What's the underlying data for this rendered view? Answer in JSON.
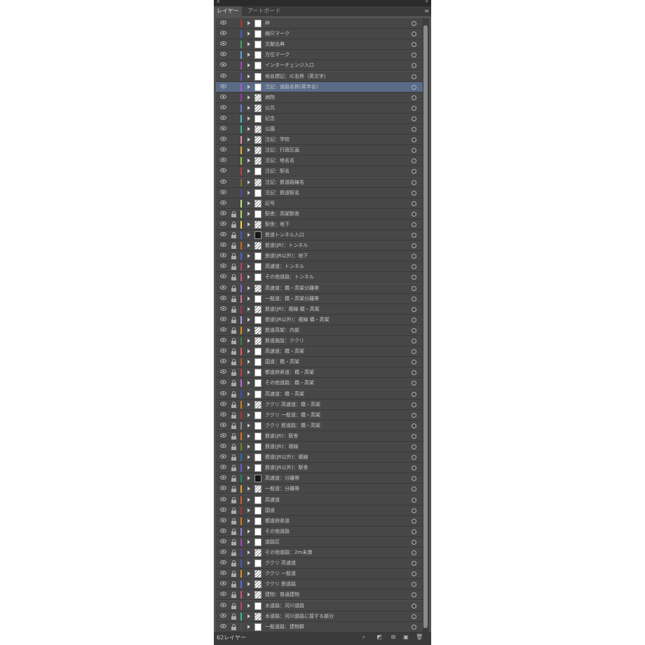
{
  "panel": {
    "tabs": [
      "レイヤー",
      "アートボード"
    ],
    "active_tab_index": 0,
    "menu_icon": "panel-menu-icon",
    "close_glyph": "x",
    "collapse_glyph": "«"
  },
  "layers": [
    {
      "name": "枠",
      "color": "#c92a2a",
      "locked": false,
      "thumb": "white"
    },
    {
      "name": "縮尺マーク",
      "color": "#3b5bdb",
      "locked": false,
      "thumb": "white"
    },
    {
      "name": "文献出典",
      "color": "#2fb24a",
      "locked": false,
      "thumb": "white"
    },
    {
      "name": "方位マーク",
      "color": "#4dabf7",
      "locked": false,
      "thumb": "white"
    },
    {
      "name": "インターチェンジ入口",
      "color": "#ae3ec9",
      "locked": false,
      "thumb": "white"
    },
    {
      "name": "地名標記：IC名称（英文字）",
      "color": "#7048e8",
      "locked": false,
      "thumb": "white"
    },
    {
      "name": "注記：道路名称(英字名)",
      "color": "#be4bdb",
      "locked": false,
      "thumb": "white",
      "selected": true
    },
    {
      "name": "病院",
      "color": "#9c36b5",
      "locked": false,
      "thumb": "drawing"
    },
    {
      "name": "公共",
      "color": "#5c7cfa",
      "locked": false,
      "thumb": "drawing"
    },
    {
      "name": "記念",
      "color": "#3bc9db",
      "locked": false,
      "thumb": "white"
    },
    {
      "name": "公園",
      "color": "#20c997",
      "locked": false,
      "thumb": "drawing"
    },
    {
      "name": "注記：学校",
      "color": "#f783ac",
      "locked": false,
      "thumb": "drawing"
    },
    {
      "name": "注記：行政区画",
      "color": "#fab005",
      "locked": false,
      "thumb": "drawing"
    },
    {
      "name": "注記：地名名",
      "color": "#94d82d",
      "locked": false,
      "thumb": "drawing"
    },
    {
      "name": "注記：駅名",
      "color": "#e03131",
      "locked": false,
      "thumb": "white"
    },
    {
      "name": "注記：鉄道路線名",
      "color": "#8c6d1f",
      "locked": false,
      "thumb": "drawing"
    },
    {
      "name": "注記：鉄道駅名",
      "color": "#5f3dc4",
      "locked": false,
      "thumb": "white"
    },
    {
      "name": "記号",
      "color": "#c0eb75",
      "locked": false,
      "thumb": "drawing"
    },
    {
      "name": "駅舎：高架駅舎",
      "color": "#a9e34b",
      "locked": true,
      "thumb": "white"
    },
    {
      "name": "駅舎：地下",
      "color": "#ffd43b",
      "locked": true,
      "thumb": "drawing"
    },
    {
      "name": "鉄道トンネル入口",
      "color": "#3b5bdb",
      "locked": true,
      "thumb": "dark"
    },
    {
      "name": "鉄道(JR)：トンネル",
      "color": "#e8590c",
      "locked": true,
      "thumb": "drawing"
    },
    {
      "name": "鉄道(JR以外)：地下",
      "color": "#4263eb",
      "locked": true,
      "thumb": "white"
    },
    {
      "name": "高速道：トンネル",
      "color": "#d6336c",
      "locked": true,
      "thumb": "white"
    },
    {
      "name": "その他道路：トンネル",
      "color": "#e64980",
      "locked": true,
      "thumb": "white"
    },
    {
      "name": "高速道：橋・高架分離帯",
      "color": "#845ef7",
      "locked": true,
      "thumb": "drawing"
    },
    {
      "name": "一般道：橋・高架分離帯",
      "color": "#f06595",
      "locked": true,
      "thumb": "white"
    },
    {
      "name": "鉄道(JR)：複線 橋・高架",
      "color": "#c2255c",
      "locked": true,
      "thumb": "drawing"
    },
    {
      "name": "鉄道(JR以外)：複線 橋・高架",
      "color": "#b197fc",
      "locked": true,
      "thumb": "white"
    },
    {
      "name": "鉄道高架：内部",
      "color": "#f08c00",
      "locked": true,
      "thumb": "drawing"
    },
    {
      "name": "鉄道施設：ククリ",
      "color": "#2b8a3e",
      "locked": true,
      "thumb": "drawing"
    },
    {
      "name": "高速道：橋・高架",
      "color": "#fa5252",
      "locked": true,
      "thumb": "white"
    },
    {
      "name": "国道：橋・高架",
      "color": "#d9480f",
      "locked": true,
      "thumb": "white"
    },
    {
      "name": "都道府県道：橋・高架",
      "color": "#e03131",
      "locked": true,
      "thumb": "white"
    },
    {
      "name": "その他道路：橋・高架",
      "color": "#cc5de8",
      "locked": true,
      "thumb": "white"
    },
    {
      "name": "高速道：橋・高架",
      "color": "#364fc7",
      "locked": true,
      "thumb": "white"
    },
    {
      "name": "ククリ 高速道：橋・高架",
      "color": "#e67700",
      "locked": true,
      "thumb": "drawing"
    },
    {
      "name": "ククリ 一般道：橋・高架",
      "color": "#c92a2a",
      "locked": true,
      "thumb": "white"
    },
    {
      "name": "ククリ 鉄道路：橋・高架",
      "color": "#868e96",
      "locked": true,
      "thumb": "white"
    },
    {
      "name": "鉄道(JR)：駅舎",
      "color": "#f76707",
      "locked": true,
      "thumb": "white"
    },
    {
      "name": "鉄道(JR)：複線",
      "color": "#5c940d",
      "locked": true,
      "thumb": "white"
    },
    {
      "name": "鉄道(JR以外)：複線",
      "color": "#1971c2",
      "locked": true,
      "thumb": "white"
    },
    {
      "name": "鉄道(JR以外)：駅舎",
      "color": "#7950f2",
      "locked": true,
      "thumb": "white"
    },
    {
      "name": "高速道：分離帯",
      "color": "#099268",
      "locked": true,
      "thumb": "dark"
    },
    {
      "name": "一般道：分離帯",
      "color": "#f59f00",
      "locked": true,
      "thumb": "drawing"
    },
    {
      "name": "高速道",
      "color": "#e8590c",
      "locked": true,
      "thumb": "white"
    },
    {
      "name": "国道",
      "color": "#c92a2a",
      "locked": true,
      "thumb": "white"
    },
    {
      "name": "都道府県道",
      "color": "#e67700",
      "locked": true,
      "thumb": "white"
    },
    {
      "name": "その他道路",
      "color": "#9775fa",
      "locked": true,
      "thumb": "white"
    },
    {
      "name": "道路区",
      "color": "#ae3ec9",
      "locked": true,
      "thumb": "white"
    },
    {
      "name": "その他道路：2m未満",
      "color": "#5f3dc4",
      "locked": true,
      "thumb": "drawing"
    },
    {
      "name": "ククリ 高速道",
      "color": "#3b5bdb",
      "locked": true,
      "thumb": "white"
    },
    {
      "name": "ククリ 一般道",
      "color": "#f08c00",
      "locked": true,
      "thumb": "drawing"
    },
    {
      "name": "ククリ 鉄道路",
      "color": "#4c6ef5",
      "locked": true,
      "thumb": "drawing"
    },
    {
      "name": "建物：普通建物",
      "color": "#e64980",
      "locked": true,
      "thumb": "drawing"
    },
    {
      "name": "水道路：河川道路",
      "color": "#d6336c",
      "locked": true,
      "thumb": "white"
    },
    {
      "name": "水道路：河川道路に接する部分",
      "color": "#20c997",
      "locked": true,
      "thumb": "drawing"
    },
    {
      "name": "一般道路：建物群",
      "color": "#495057",
      "locked": true,
      "thumb": "white"
    }
  ],
  "footer": {
    "count_label": "62レイヤー",
    "icons": [
      "locate-object-icon",
      "make-clipping-mask-icon",
      "create-sublayer-icon",
      "new-layer-icon",
      "delete-layer-icon"
    ]
  }
}
